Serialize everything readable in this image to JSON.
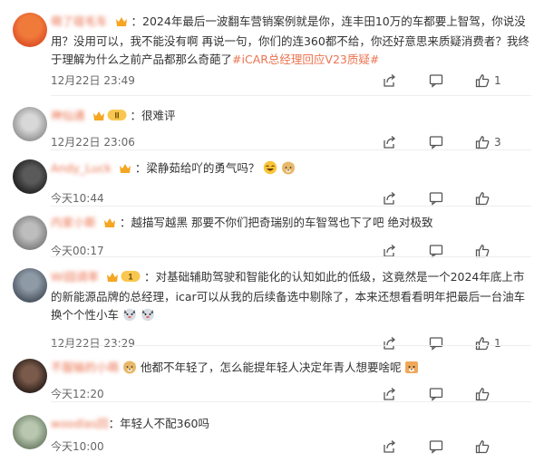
{
  "comments": [
    {
      "user": "萌了碰毛车",
      "text": "2024年最后一波翻车营销案例就是你，连丰田10万的车都要上智驾，你说没用？没用可以，我不能没有啊 再说一句，你们的连360都不给，你还好意思来质疑消费者？我终于理解为什么之前产品都那么奇葩了",
      "topic": "#iCAR总经理回应V23质疑#",
      "time": "12月22日 23:49",
      "likes": "1"
    },
    {
      "user": "神仙通",
      "level": "II",
      "text": "很难评",
      "time": "12月22日 23:06",
      "likes": "3"
    },
    {
      "user": "Andy_Luck",
      "text": "梁静茹给吖的勇气吗？",
      "time": "今天10:44",
      "likes": ""
    },
    {
      "user": "内家小斯",
      "text": "越描写越黑 那要不你们把奇瑞别的车智驾也下了吧 绝对极致",
      "time": "今天00:17",
      "likes": ""
    },
    {
      "user": "Wi园调率",
      "level": "1",
      "text": "对基础辅助驾驶和智能化的认知如此的低级，这竟然是一个2024年底上市的新能源品牌的总经理，icar可以从我的后续备选中剔除了，本来还想看看明年把最后一台油车换个个性小车",
      "time": "12月22日 23:29",
      "likes": "1"
    },
    {
      "user": "不服输的小萌",
      "text": "他都不年轻了，怎么能提年轻人决定年青人想要啥呢",
      "time": "今天12:20",
      "likes": ""
    },
    {
      "user": "woodlas回",
      "text": "年轻人不配360吗",
      "time": "今天10:00",
      "likes": ""
    }
  ],
  "icons": {
    "share": "share-icon",
    "comment": "comment-icon",
    "like": "thumbs-up-icon",
    "vip": "crown-icon"
  },
  "colors": {
    "username": "#eb7350",
    "topic": "#eb7350",
    "text": "#333333",
    "meta": "#666666",
    "vip": "#f5a623"
  }
}
